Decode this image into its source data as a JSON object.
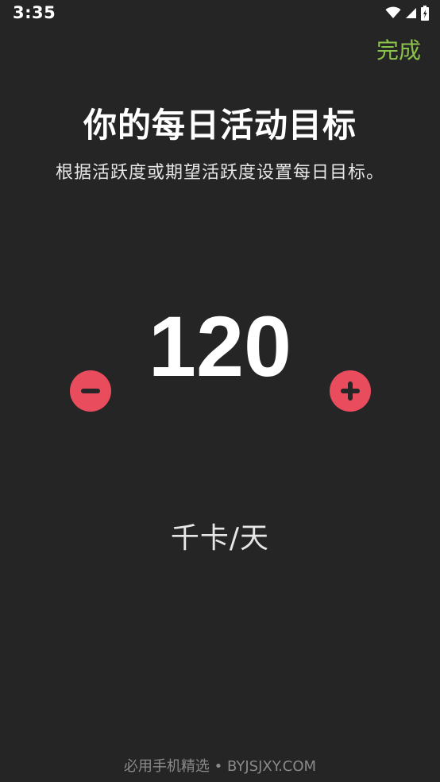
{
  "status_bar": {
    "time": "3:35"
  },
  "toolbar": {
    "done_label": "完成"
  },
  "header": {
    "title": "你的每日活动目标",
    "subtitle": "根据活跃度或期望活跃度设置每日目标。"
  },
  "goal": {
    "value": "120",
    "unit": "千卡/天"
  },
  "footer": {
    "watermark": "必用手机精选 • BYJSJXY.COM"
  },
  "icons": {
    "wifi": "wifi-icon",
    "signal": "cellular-signal-icon",
    "battery": "battery-charging-icon",
    "decrease": "minus-icon",
    "increase": "plus-icon"
  },
  "colors": {
    "background": "#252525",
    "accent": "#8bc34a",
    "button": "#e84c5d",
    "text": "#ffffff"
  }
}
